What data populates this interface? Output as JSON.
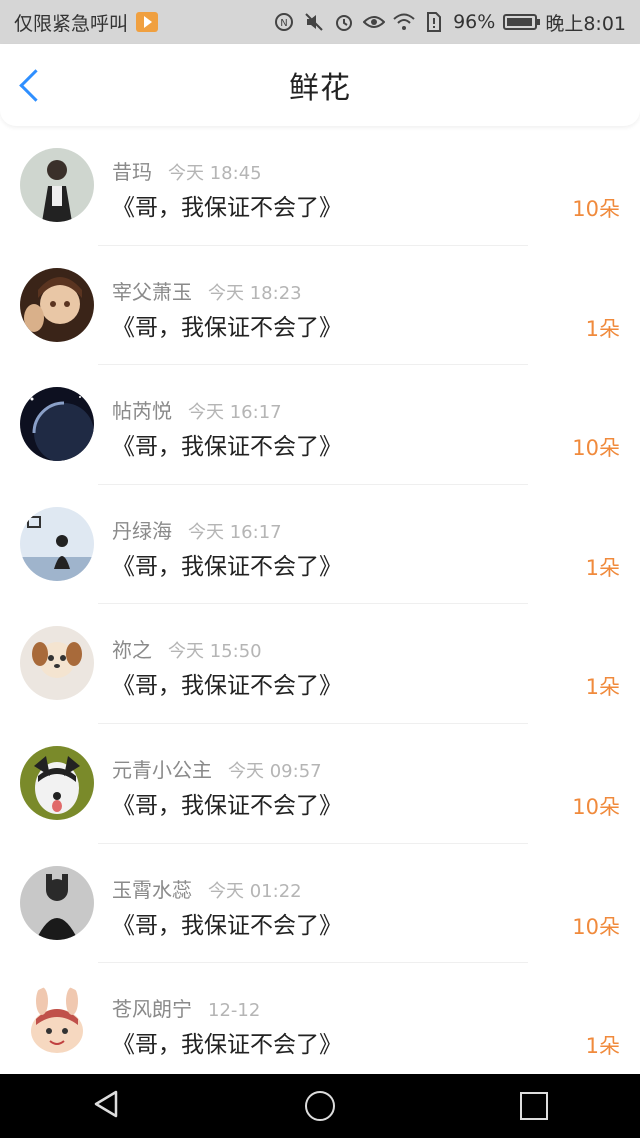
{
  "status_bar": {
    "left_text": "仅限紧急呼叫",
    "battery": "96%",
    "time": "晚上8:01",
    "battery_level": 0.96,
    "icons": [
      "play-icon",
      "nfc-icon",
      "mute-icon",
      "alarm-icon",
      "eye-icon",
      "wifi-icon",
      "sim-icon",
      "battery-icon"
    ]
  },
  "header": {
    "title": "鲜花",
    "back_icon": "chevron-left-icon",
    "accent": "#2f8fff"
  },
  "list": [
    {
      "name": "昔玛",
      "time": "今天 18:45",
      "message": "《哥，我保证不会了》",
      "count": "10朵"
    },
    {
      "name": "宰父萧玉",
      "time": "今天 18:23",
      "message": "《哥，我保证不会了》",
      "count": "1朵"
    },
    {
      "name": "帖芮悦",
      "time": "今天 16:17",
      "message": "《哥，我保证不会了》",
      "count": "10朵"
    },
    {
      "name": "丹绿海",
      "time": "今天 16:17",
      "message": "《哥，我保证不会了》",
      "count": "1朵"
    },
    {
      "name": "祢之",
      "time": "今天 15:50",
      "message": "《哥，我保证不会了》",
      "count": "1朵"
    },
    {
      "name": "元青小公主",
      "time": "今天 09:57",
      "message": "《哥，我保证不会了》",
      "count": "10朵"
    },
    {
      "name": "玉霄水蕊",
      "time": "今天 01:22",
      "message": "《哥，我保证不会了》",
      "count": "10朵"
    },
    {
      "name": "苍风朗宁",
      "time": "12-12",
      "message": "《哥，我保证不会了》",
      "count": "1朵"
    }
  ],
  "count_color": "#f08a3c",
  "nav_bar": {
    "icons": [
      "nav-back-icon",
      "nav-home-icon",
      "nav-recents-icon"
    ]
  }
}
